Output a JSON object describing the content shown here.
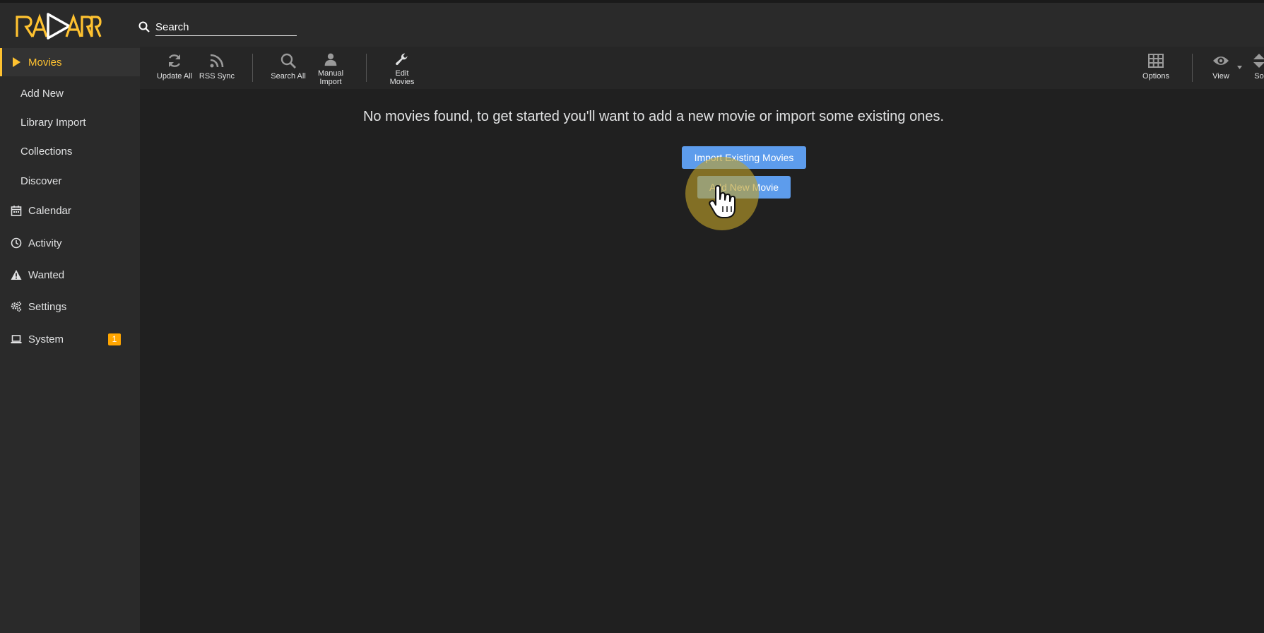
{
  "app": {
    "logo_name": "radarr-logo",
    "accent_color": "#ffc230",
    "button_color": "#5d9cec"
  },
  "search": {
    "placeholder": "Search",
    "value": ""
  },
  "sidebar": {
    "items": [
      {
        "label": "Movies",
        "icon": "play-icon",
        "active": true
      },
      {
        "label": "Add New",
        "sub": true
      },
      {
        "label": "Library Import",
        "sub": true
      },
      {
        "label": "Collections",
        "sub": true
      },
      {
        "label": "Discover",
        "sub": true
      },
      {
        "label": "Calendar",
        "icon": "calendar-icon"
      },
      {
        "label": "Activity",
        "icon": "clock-icon"
      },
      {
        "label": "Wanted",
        "icon": "warning-icon"
      },
      {
        "label": "Settings",
        "icon": "gears-icon"
      },
      {
        "label": "System",
        "icon": "laptop-icon",
        "badge": "1",
        "badge_color": "#ffa500"
      }
    ]
  },
  "toolbar": {
    "update_all": "Update All",
    "rss_sync": "RSS Sync",
    "search_all": "Search All",
    "manual_import_line1": "Manual",
    "manual_import_line2": "Import",
    "edit_movies_line1": "Edit",
    "edit_movies_line2": "Movies",
    "options": "Options",
    "view": "View",
    "sort_partial": "So"
  },
  "main": {
    "empty_message": "No movies found, to get started you'll want to add a new movie or import some existing ones.",
    "import_button": "Import Existing Movies",
    "add_button": "Add New Movie"
  }
}
